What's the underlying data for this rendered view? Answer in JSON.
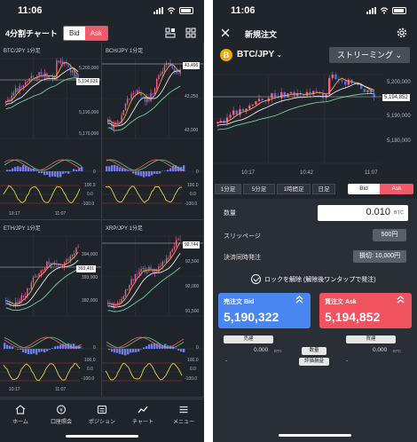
{
  "left": {
    "status": {
      "time": "11:06"
    },
    "header": {
      "title": "4分割チャート",
      "bid_label": "Bid",
      "ask_label": "Ask",
      "icons": [
        "layout-icon",
        "grid-icon"
      ]
    },
    "panels": [
      {
        "label": "BTC/JPY  1分足",
        "prices": [
          "5,200,000",
          "5,190,000",
          "5,180,000",
          "5,170,000"
        ],
        "badge": "5,194,636",
        "osc1": [
          "0"
        ],
        "osc2": [
          "100.0",
          "0.0",
          "-100.0"
        ],
        "times": [
          "10:17",
          "11:07"
        ]
      },
      {
        "label": "BCH/JPY  1分足",
        "prices": [
          "43,500",
          "43,250",
          "43,000"
        ],
        "badge": "43,496",
        "osc1": [
          "0"
        ],
        "osc2": [
          "100.0",
          "0.0",
          "-100.0"
        ],
        "times": [
          "10:17",
          "11:07"
        ]
      },
      {
        "label": "ETH/JPY  1分足",
        "prices": [
          "394,000",
          "393,000",
          "392,000"
        ],
        "badge": "393,401",
        "osc1": [
          "0"
        ],
        "osc2": [
          "100.0",
          "0.0",
          "-100.0"
        ],
        "times": [
          "10:17",
          "11:07"
        ]
      },
      {
        "label": "XRP/JPY  1分足",
        "prices": [
          "92,500",
          "92,000",
          "91,500"
        ],
        "badge": "92,744",
        "osc1": [
          "0"
        ],
        "osc2": [
          "100.0",
          "0.0",
          "-100.0"
        ],
        "times": [
          "10:17",
          "11:07"
        ]
      }
    ],
    "tabs": [
      {
        "label": "ホーム",
        "icon": "home-icon"
      },
      {
        "label": "口座照会",
        "icon": "account-icon"
      },
      {
        "label": "ポジション",
        "icon": "position-icon"
      },
      {
        "label": "チャート",
        "icon": "chart-icon"
      },
      {
        "label": "メニュー",
        "icon": "menu-icon"
      }
    ]
  },
  "right": {
    "status": {
      "time": "11:06"
    },
    "header": {
      "title": "新規注文",
      "close_icon": "close-icon",
      "settings_icon": "gear-icon"
    },
    "pair": {
      "coin_symbol": "B",
      "name": "BTC/JPY",
      "mode": "ストリーミング"
    },
    "chart": {
      "prices": [
        "5,200,000",
        "5,190,000",
        "5,180,000"
      ],
      "badge": "5,194,852",
      "times": [
        "10:17",
        "10:42",
        "11:07"
      ]
    },
    "timeframes": [
      "1分足",
      "5分足",
      "1時間足",
      "日足"
    ],
    "side": {
      "bid": "Bid",
      "ask": "Ask"
    },
    "quantity": {
      "label": "数量",
      "value": "0.010",
      "unit": "BTC"
    },
    "slippage": {
      "label": "スリッページ",
      "value": "500円"
    },
    "settlement": {
      "label": "決済同時発注",
      "value": "損切: 10,000円"
    },
    "lock": {
      "text": "ロックを解除 (解除後ワンタップで発注)"
    },
    "sell": {
      "label": "売注文 Bid",
      "price": "5,190,322",
      "color": "#4a86f2"
    },
    "buy": {
      "label": "買注文 Ask",
      "price": "5,194,852",
      "color": "#f0525f"
    },
    "positions": {
      "sell_label": "売建",
      "buy_label": "買建",
      "qty_label": "数量",
      "pnl_label": "評価損益",
      "sell_qty": "0.000",
      "buy_qty": "0.000",
      "unit": "BTC",
      "sell_pnl": "-",
      "buy_pnl": "-"
    }
  }
}
